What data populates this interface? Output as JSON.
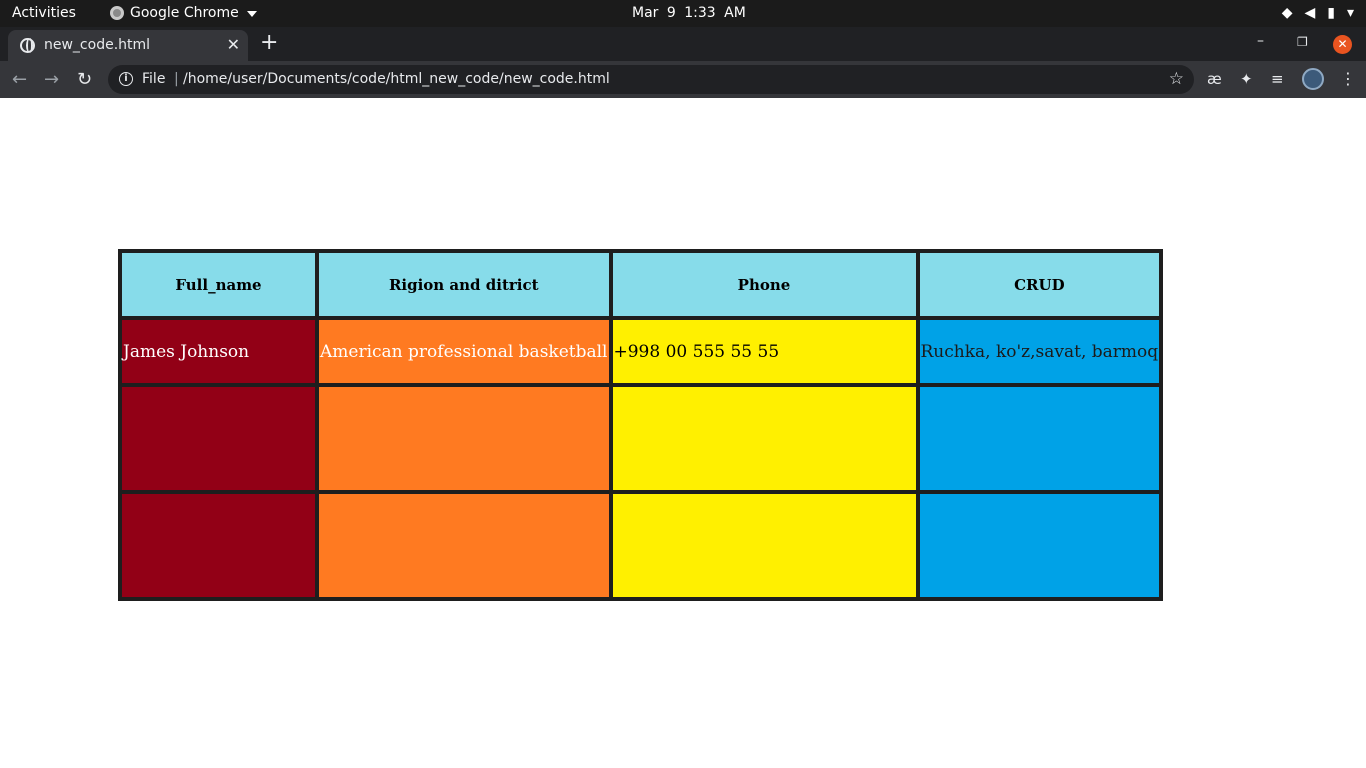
{
  "topbar": {
    "activities": "Activities",
    "app_name": "Google Chrome",
    "clock": "Mar 9  1:33 AM"
  },
  "browser": {
    "tab_title": "new_code.html",
    "new_tab_symbol": "+",
    "scheme_label": "File",
    "url": "/home/user/Documents/code/html_new_code/new_code.html"
  },
  "icons": {
    "back": "arrow-left-icon",
    "forward": "arrow-right-icon",
    "reload": "reload-icon",
    "info": "info-icon",
    "star": "star-icon",
    "menu": "kebab-menu-icon"
  },
  "table": {
    "headers": [
      "Full_name",
      "Rigion and ditrict",
      "Phone",
      "CRUD"
    ],
    "rows": [
      [
        "James Johnson",
        "American professional basketball",
        "+998 00 555 55 55",
        "Ruchka, ko'z,savat, barmoq"
      ],
      [
        "",
        "",
        "",
        ""
      ],
      [
        "",
        "",
        "",
        ""
      ]
    ],
    "colors": {
      "border": "#1e1e1e",
      "header_bg": "#87dcea",
      "col1_bg": "#920016",
      "col2_bg": "#ff7a21",
      "col3_bg": "#fff000",
      "col4_bg": "#00a2e7"
    }
  }
}
